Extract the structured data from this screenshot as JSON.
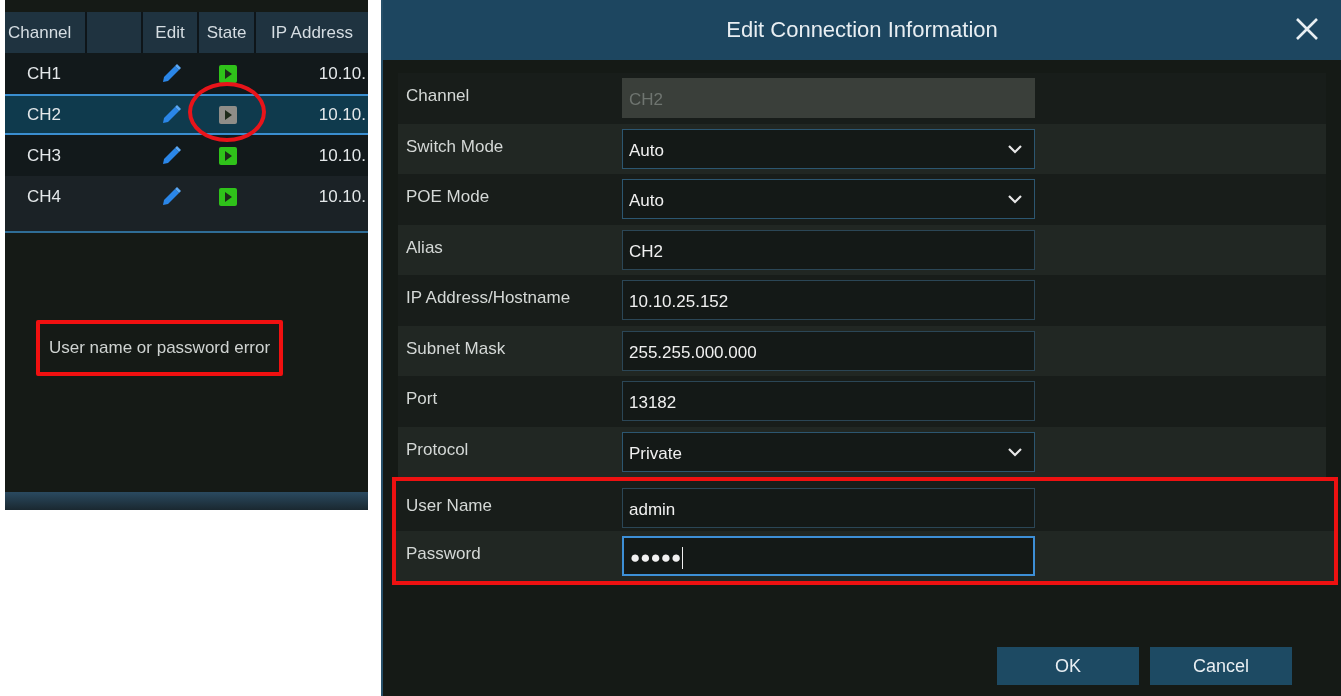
{
  "channel_list": {
    "columns": [
      "Channel",
      "Edit",
      "State",
      "IP Address"
    ],
    "rows": [
      {
        "channel": "CH1",
        "online": true,
        "selected": false,
        "circled": false,
        "ip": "10.10."
      },
      {
        "channel": "CH2",
        "online": false,
        "selected": true,
        "circled": true,
        "ip": "10.10."
      },
      {
        "channel": "CH3",
        "online": true,
        "selected": false,
        "circled": false,
        "ip": "10.10."
      },
      {
        "channel": "CH4",
        "online": true,
        "selected": false,
        "circled": false,
        "ip": "10.10."
      }
    ],
    "message": {
      "text": "User name or password error",
      "highlighted": true
    }
  },
  "dialog": {
    "title": "Edit Connection Information",
    "fields": [
      {
        "label": "Channel",
        "kind": "text",
        "value": "CH2",
        "disabled": true,
        "focused": false,
        "highlighted": false
      },
      {
        "label": "Switch Mode",
        "kind": "select",
        "value": "Auto",
        "disabled": false,
        "focused": false,
        "highlighted": false
      },
      {
        "label": "POE Mode",
        "kind": "select",
        "value": "Auto",
        "disabled": false,
        "focused": false,
        "highlighted": false
      },
      {
        "label": "Alias",
        "kind": "text",
        "value": "CH2",
        "disabled": false,
        "focused": false,
        "highlighted": false
      },
      {
        "label": "IP Address/Hostname",
        "kind": "text",
        "value": "10.10.25.152",
        "disabled": false,
        "focused": false,
        "highlighted": false
      },
      {
        "label": "Subnet Mask",
        "kind": "text",
        "value": "255.255.000.000",
        "disabled": false,
        "focused": false,
        "highlighted": false
      },
      {
        "label": "Port",
        "kind": "text",
        "value": "13182",
        "disabled": false,
        "focused": false,
        "highlighted": false
      },
      {
        "label": "Protocol",
        "kind": "select",
        "value": "Private",
        "disabled": false,
        "focused": false,
        "highlighted": false
      },
      {
        "label": "User Name",
        "kind": "text",
        "value": "admin",
        "disabled": false,
        "focused": false,
        "highlighted": true
      },
      {
        "label": "Password",
        "kind": "text",
        "value": "●●●●●",
        "disabled": false,
        "focused": true,
        "highlighted": true
      }
    ],
    "buttons": [
      "OK",
      "Cancel"
    ]
  }
}
